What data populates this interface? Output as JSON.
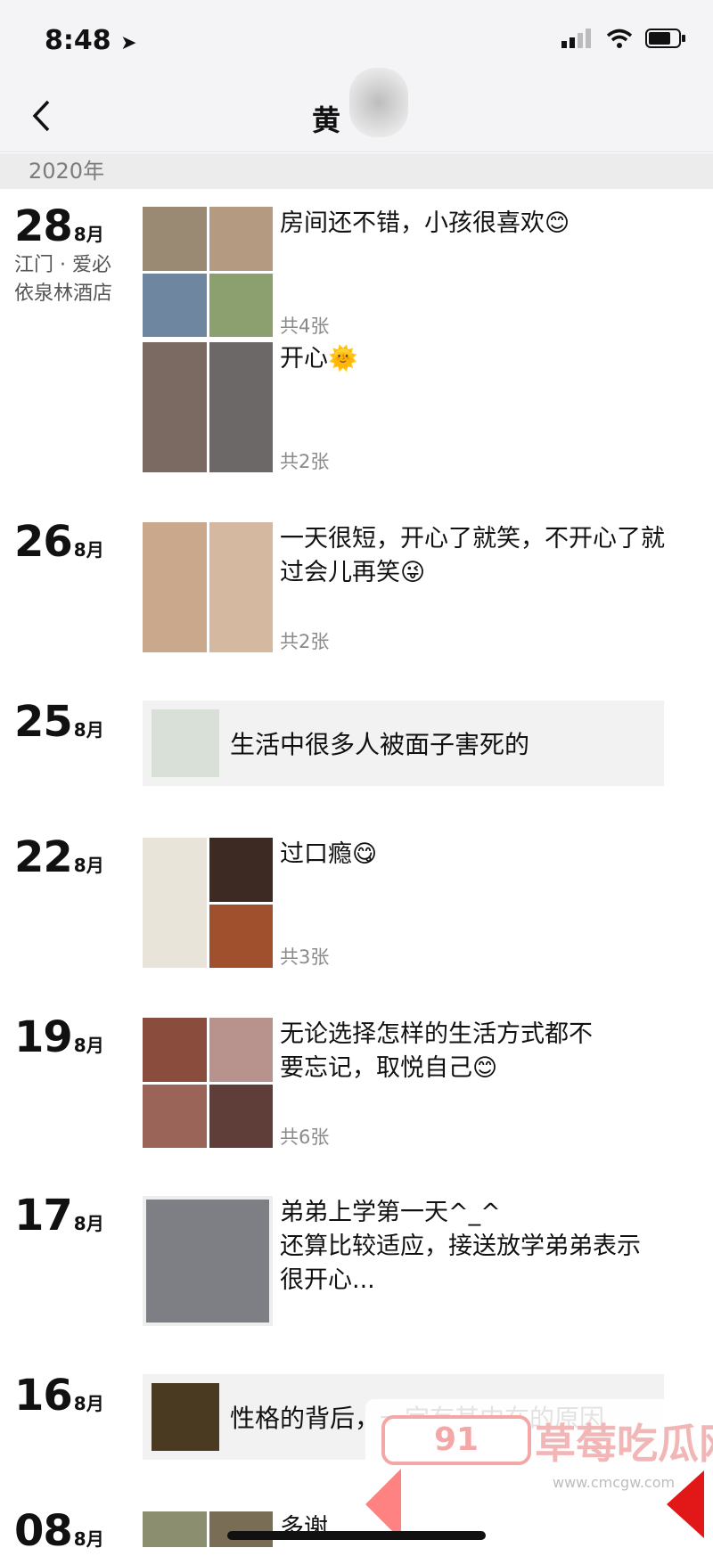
{
  "status": {
    "time": "8:48"
  },
  "nav": {
    "title": "黄"
  },
  "year": "2020年",
  "entries": [
    {
      "day": "28",
      "month": "8月",
      "location": "江门 · 爱必依泉林酒店",
      "posts": [
        {
          "text": "房间还不错，小孩很喜欢😊",
          "count": "共4张",
          "photos": [
            "#9a8a74",
            "#b59a82",
            "#6f86a0",
            "#8ba06e"
          ]
        },
        {
          "text": "开心🌞",
          "count": "共2张",
          "photos": [
            "#7b6a62",
            "#6d6868"
          ]
        }
      ]
    },
    {
      "day": "26",
      "month": "8月",
      "posts": [
        {
          "text": "一天很短，开心了就笑，不开心了就过会儿再笑😜",
          "count": "共2张",
          "photos": [
            "#c9a88c",
            "#d4b9a0"
          ]
        }
      ]
    },
    {
      "day": "25",
      "month": "8月",
      "link": "生活中很多人被面子害死的"
    },
    {
      "day": "22",
      "month": "8月",
      "posts": [
        {
          "text": "过口瘾😋",
          "count": "共3张",
          "photos": [
            "#e9e4da",
            "#3d2a22",
            "#a0502c"
          ]
        }
      ]
    },
    {
      "day": "19",
      "month": "8月",
      "posts": [
        {
          "text": "无论选择怎样的生活方式都不要忘记，取悦自己😊",
          "count": "共6张",
          "photos": [
            "#8a4c3c",
            "#b8928c",
            "#9a6458",
            "#5f3e3a"
          ]
        }
      ]
    },
    {
      "day": "17",
      "month": "8月",
      "posts": [
        {
          "text": "弟弟上学第一天^_^\n还算比较适应，接送放学弟弟表示很开心...",
          "photos": [
            "#7d7f84"
          ]
        }
      ]
    },
    {
      "day": "16",
      "month": "8月",
      "link": "性格的背后，一定有其内在的原因"
    },
    {
      "day": "08",
      "month": "8月",
      "posts": [
        {
          "text": "多谢...",
          "photos": [
            "#8b8f70",
            "#7a6d55"
          ]
        }
      ]
    }
  ],
  "watermark": {
    "logo": "91",
    "text": "草莓吃瓜网",
    "url": "www.cmcgw.com"
  }
}
